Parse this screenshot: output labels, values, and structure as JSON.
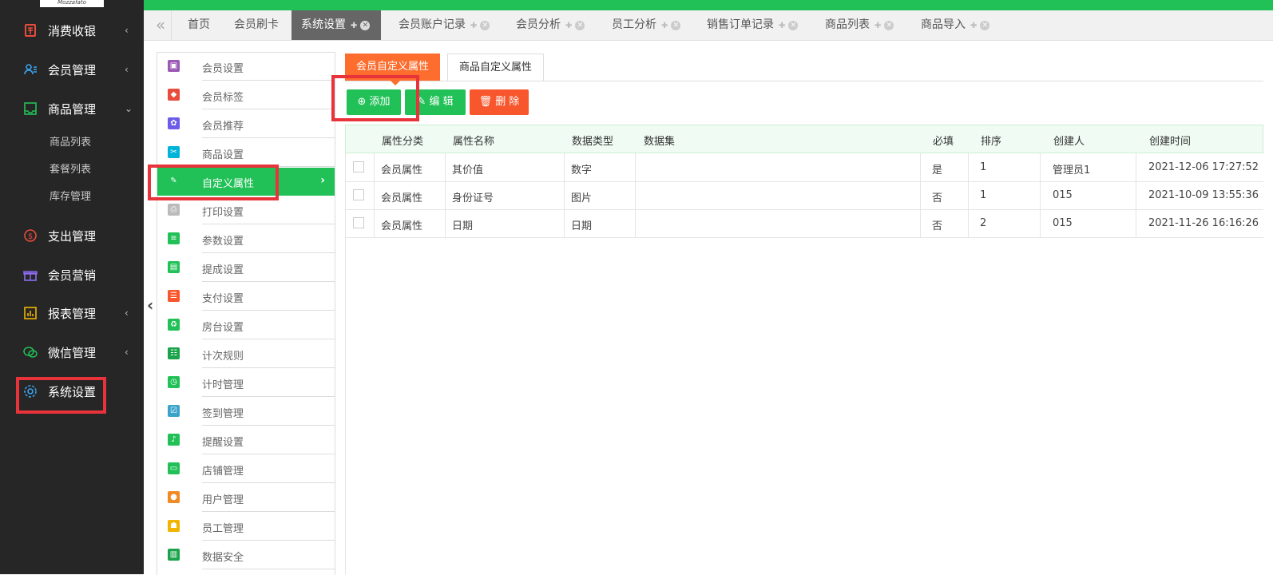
{
  "sidebar": {
    "logo_text": "Mozzafato",
    "items": [
      {
        "label": "消费收银",
        "arrow": "‹"
      },
      {
        "label": "会员管理",
        "arrow": "‹"
      },
      {
        "label": "商品管理",
        "arrow": "⌄"
      },
      {
        "label": "支出管理",
        "arrow": ""
      },
      {
        "label": "会员营销",
        "arrow": ""
      },
      {
        "label": "报表管理",
        "arrow": "‹"
      },
      {
        "label": "微信管理",
        "arrow": "‹"
      },
      {
        "label": "系统设置",
        "arrow": ""
      }
    ],
    "sub_items": [
      "商品列表",
      "套餐列表",
      "库存管理"
    ]
  },
  "tabs": [
    {
      "label": "首页"
    },
    {
      "label": "会员刷卡"
    },
    {
      "label": "系统设置"
    },
    {
      "label": "会员账户记录"
    },
    {
      "label": "会员分析"
    },
    {
      "label": "员工分析"
    },
    {
      "label": "销售订单记录"
    },
    {
      "label": "商品列表"
    },
    {
      "label": "商品导入"
    }
  ],
  "settings_menu": [
    {
      "label": "会员设置",
      "color": "#9b59b6"
    },
    {
      "label": "会员标签",
      "color": "#e74c3c"
    },
    {
      "label": "会员推荐",
      "color": "#6c5ce7"
    },
    {
      "label": "商品设置",
      "color": "#00b4d8"
    },
    {
      "label": "自定义属性",
      "color": "#21c157"
    },
    {
      "label": "打印设置",
      "color": "#bbbbbb"
    },
    {
      "label": "参数设置",
      "color": "#21c157"
    },
    {
      "label": "提成设置",
      "color": "#21c157"
    },
    {
      "label": "支付设置",
      "color": "#f8562d"
    },
    {
      "label": "房台设置",
      "color": "#21c157"
    },
    {
      "label": "计次规则",
      "color": "#1aa34a"
    },
    {
      "label": "计时管理",
      "color": "#21c157"
    },
    {
      "label": "签到管理",
      "color": "#3ba3c9"
    },
    {
      "label": "提醒设置",
      "color": "#21c157"
    },
    {
      "label": "店铺管理",
      "color": "#21c157"
    },
    {
      "label": "用户管理",
      "color": "#f08a24"
    },
    {
      "label": "员工管理",
      "color": "#f1b400"
    },
    {
      "label": "数据安全",
      "color": "#1aa34a"
    }
  ],
  "content_tabs": {
    "member": "会员自定义属性",
    "product": "商品自定义属性"
  },
  "toolbar": {
    "add": "添加",
    "edit": "编 辑",
    "delete": "删 除"
  },
  "table": {
    "headers": [
      "属性分类",
      "属性名称",
      "数据类型",
      "数据集",
      "必填",
      "排序",
      "创建人",
      "创建时间"
    ],
    "rows": [
      [
        "会员属性",
        "其价值",
        "数字",
        "",
        "是",
        "1",
        "管理员1",
        "2021-12-06 17:27:52"
      ],
      [
        "会员属性",
        "身份证号",
        "图片",
        "",
        "否",
        "1",
        "015",
        "2021-10-09 13:55:36"
      ],
      [
        "会员属性",
        "日期",
        "日期",
        "",
        "否",
        "2",
        "015",
        "2021-11-26 16:16:26"
      ]
    ]
  },
  "colors": {
    "green": "#21c157",
    "orange": "#fc6d2e",
    "sidebar": "#262626",
    "highlight": "#e8333a"
  }
}
